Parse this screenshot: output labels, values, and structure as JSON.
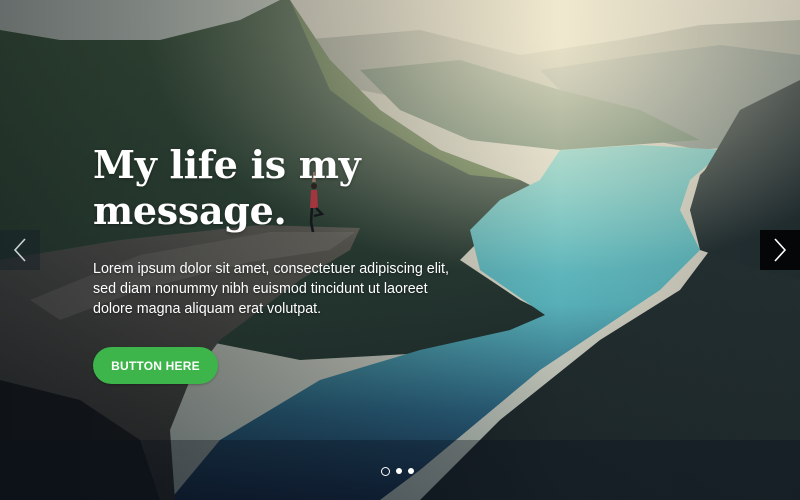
{
  "slider": {
    "headline": "My life is my message.",
    "body": "Lorem ipsum dolor sit amet, consectetuer adipiscing elit, sed diam nonummy nibh euismod tincidunt ut laoreet dolore magna aliquam erat volutpat.",
    "button_label": "BUTTON HERE",
    "prev_icon": "chevron-left-icon",
    "next_icon": "chevron-right-icon",
    "dots": {
      "count": 3,
      "active_index": 0
    },
    "colors": {
      "button": "#3db54a",
      "text": "#ffffff",
      "next_bg": "#000000"
    }
  }
}
